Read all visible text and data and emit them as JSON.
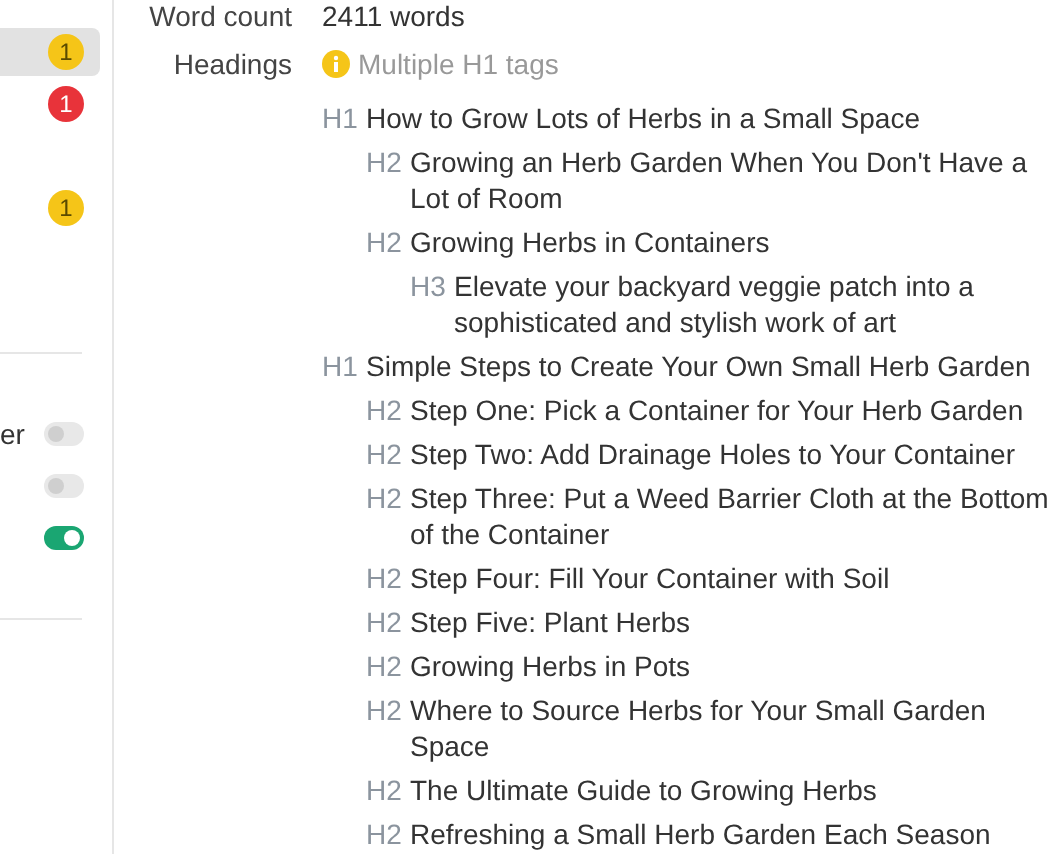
{
  "sidebar": {
    "items": [
      {
        "badge": "1",
        "color": "#f5c518",
        "selected": true
      },
      {
        "badge": "1",
        "color": "#e8333a",
        "selected": false
      },
      {
        "badge": "1",
        "color": "#f5c518",
        "selected": false
      }
    ],
    "toggles": [
      {
        "label": "er",
        "on": false
      },
      {
        "on": false
      },
      {
        "on": true
      }
    ]
  },
  "details": {
    "word_count": {
      "label": "Word count",
      "value": "2411 words"
    },
    "headings": {
      "label": "Headings",
      "warning": "Multiple H1 tags",
      "tree": [
        {
          "tag": "H1",
          "text": "How to Grow Lots of Herbs in a Small Space",
          "children": [
            {
              "tag": "H2",
              "text": "Growing an Herb Garden When You Don't Have a Lot of Room"
            },
            {
              "tag": "H2",
              "text": "Growing Herbs in Containers",
              "children": [
                {
                  "tag": "H3",
                  "text": "Elevate your backyard veggie patch into a sophisticated and stylish work of art"
                }
              ]
            }
          ]
        },
        {
          "tag": "H1",
          "text": "Simple Steps to Create Your Own Small Herb Garden",
          "children": [
            {
              "tag": "H2",
              "text": "Step One: Pick a Container for Your Herb Garden"
            },
            {
              "tag": "H2",
              "text": "Step Two: Add Drainage Holes to Your Container"
            },
            {
              "tag": "H2",
              "text": "Step Three: Put a Weed Barrier Cloth at the Bottom of the Container"
            },
            {
              "tag": "H2",
              "text": "Step Four: Fill Your Container with Soil"
            },
            {
              "tag": "H2",
              "text": "Step Five: Plant Herbs"
            },
            {
              "tag": "H2",
              "text": "Growing Herbs in Pots"
            },
            {
              "tag": "H2",
              "text": "Where to Source Herbs for Your Small Garden Space"
            },
            {
              "tag": "H2",
              "text": "The Ultimate Guide to Growing Herbs"
            },
            {
              "tag": "H2",
              "text": "Refreshing a Small Herb Garden Each Season"
            }
          ]
        }
      ]
    }
  }
}
